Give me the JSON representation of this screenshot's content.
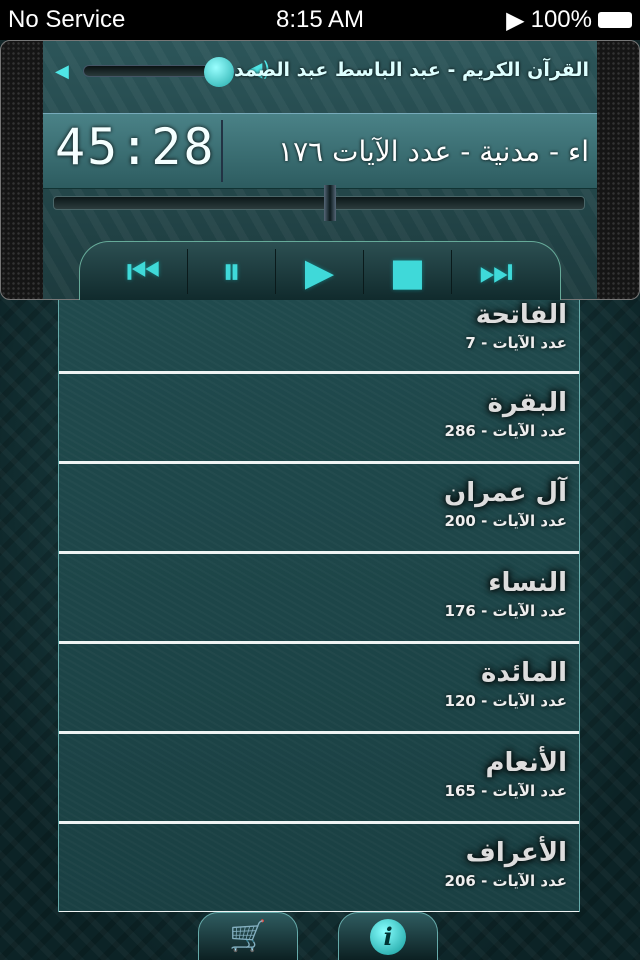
{
  "status_bar": {
    "carrier": "No Service",
    "time": "8:15 AM",
    "battery": "100%"
  },
  "player": {
    "title": "القرآن الكريم - عبد الباسط عبد الصمد",
    "elapsed": "45:28",
    "now_playing": "اء - مدنية - عدد الآيات ١٧٦",
    "volume_level": 0.9,
    "progress": 0.52,
    "controls": [
      {
        "name": "previous",
        "icon": "skip-back-icon",
        "glyph": "⏮"
      },
      {
        "name": "pause",
        "icon": "pause-icon",
        "glyph": "⏸"
      },
      {
        "name": "play",
        "icon": "play-icon",
        "glyph": "▶"
      },
      {
        "name": "stop",
        "icon": "stop-icon",
        "glyph": "■"
      },
      {
        "name": "next",
        "icon": "skip-forward-icon",
        "glyph": "⏭"
      }
    ],
    "accent": "#3fd9d9"
  },
  "surahs": [
    {
      "name": "الفاتحة",
      "ayat": "عدد الآيات - 7"
    },
    {
      "name": "البقرة",
      "ayat": "عدد الآيات - 286"
    },
    {
      "name": "آل عمران",
      "ayat": "عدد الآيات - 200"
    },
    {
      "name": "النساء",
      "ayat": "عدد الآيات - 176"
    },
    {
      "name": "المائدة",
      "ayat": "عدد الآيات - 120"
    },
    {
      "name": "الأنعام",
      "ayat": "عدد الآيات - 165"
    },
    {
      "name": "الأعراف",
      "ayat": "عدد الآيات - 206"
    }
  ],
  "tabs": [
    {
      "icon": "cart-icon",
      "glyph": "🛒"
    },
    {
      "icon": "info-icon",
      "glyph": "i"
    }
  ]
}
